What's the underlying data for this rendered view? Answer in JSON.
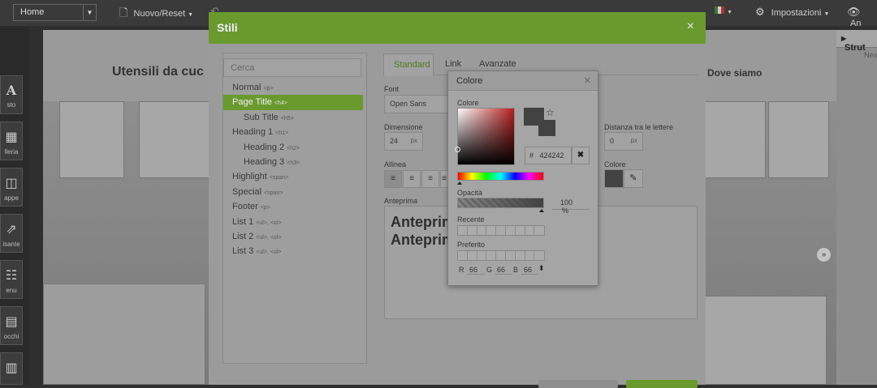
{
  "topbar": {
    "page_select": "Home",
    "new_reset": "Nuovo/Reset",
    "settings": "Impostazioni",
    "preview": "An"
  },
  "sidebar": {
    "items": [
      {
        "icon": "text-icon",
        "label": "sto"
      },
      {
        "icon": "gallery-icon",
        "label": "lleria"
      },
      {
        "icon": "map-icon",
        "label": "appe"
      },
      {
        "icon": "share-icon",
        "label": "isante"
      },
      {
        "icon": "menu-icon",
        "label": "enu"
      },
      {
        "icon": "blocks-icon",
        "label": "occhi"
      }
    ]
  },
  "site": {
    "title": "Utensili da cuc",
    "nav_item": "Dove siamo"
  },
  "right_panel": {
    "title": "Strut",
    "sub": "Nes"
  },
  "modal": {
    "title": "Stili",
    "close": "×",
    "search_placeholder": "Cerca",
    "styles": [
      {
        "name": "Normal",
        "tag": "<p>",
        "indent": false,
        "selected": false
      },
      {
        "name": "Page Title",
        "tag": "<h4>",
        "indent": false,
        "selected": true
      },
      {
        "name": "Sub Title",
        "tag": "<h5>",
        "indent": true,
        "selected": false
      },
      {
        "name": "Heading 1",
        "tag": "<h1>",
        "indent": false,
        "selected": false
      },
      {
        "name": "Heading 2",
        "tag": "<h2>",
        "indent": true,
        "selected": false
      },
      {
        "name": "Heading 3",
        "tag": "<h3>",
        "indent": true,
        "selected": false
      },
      {
        "name": "Highlight",
        "tag": "<span>",
        "indent": false,
        "selected": false
      },
      {
        "name": "Special",
        "tag": "<span>",
        "indent": false,
        "selected": false
      },
      {
        "name": "Footer",
        "tag": "<p>",
        "indent": false,
        "selected": false
      },
      {
        "name": "List 1",
        "tag": "<ul>, <ol>",
        "indent": false,
        "selected": false
      },
      {
        "name": "List 2",
        "tag": "<ul>, <ol>",
        "indent": false,
        "selected": false
      },
      {
        "name": "List 3",
        "tag": "<ul>, <ol>",
        "indent": false,
        "selected": false
      }
    ],
    "tabs": [
      "Standard",
      "Link",
      "Avanzate"
    ],
    "active_tab": "Standard",
    "font_label": "Font",
    "font_value": "Open Sans",
    "size_label": "Dimensione",
    "size_value": "24",
    "size_unit": "px",
    "letter_spacing_label": "Distanza tra le lettere",
    "letter_spacing_value": "0",
    "letter_spacing_unit": "px",
    "align_label": "Allinea",
    "color_label": "Colore",
    "color_value": "#424242",
    "preview_label": "Anteprima",
    "preview_lines": [
      "Anteprima",
      "Anteprima"
    ]
  },
  "color_popup": {
    "title": "Colore",
    "color_label": "Colore",
    "hex": "424242",
    "opacity_label": "Opacità",
    "opacity_value": "100",
    "opacity_unit": "%",
    "recent_label": "Recente",
    "favorite_label": "Preferito",
    "r_label": "R",
    "r": "66",
    "g_label": "G",
    "g": "66",
    "b_label": "B",
    "b": "66",
    "current_color": "#424242",
    "hue_color": "#b61e1e"
  }
}
